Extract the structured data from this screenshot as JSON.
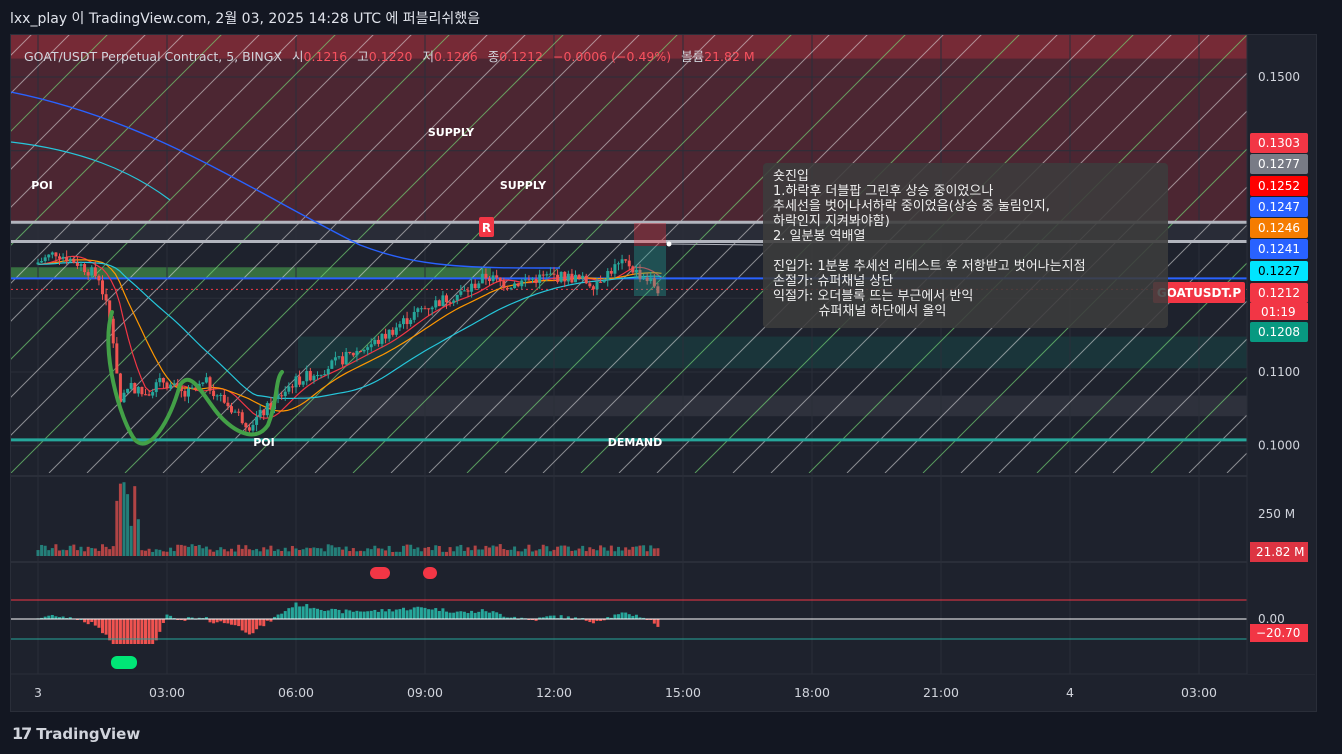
{
  "caption": "lxx_play 이 TradingView.com, 2월 03, 2025 14:28 UTC 에 퍼블리쉬했음",
  "brand": "TradingView",
  "symbol": {
    "name": "GOAT/USDT Perpetual Contract, 5, BINGX",
    "open_label": "시",
    "open": "0.1216",
    "high_label": "고",
    "high": "0.1220",
    "low_label": "저",
    "low": "0.1206",
    "close_label": "종",
    "close": "0.1212",
    "change": "−0.0006 (−0.49%)",
    "volume_label": "볼륨",
    "volume": "21.82 M"
  },
  "note": {
    "title": "숏진입",
    "lines": [
      "1.하락후 더블팝 그린후 상승 중이었으나",
      "추세선을 벗어나서하락 중이었음(상승 중 눌림인지,",
      "하락인지 지켜봐야함)",
      "2. 일분봉 역배열",
      "",
      "진입가: 1분봉 추세선 리테스트 후 저항받고 벗어나는지점",
      "손절가: 슈퍼채널 상단",
      "익절가: 오더블록 뜨는 부근에서 반익",
      "           슈퍼채널 하단에서 올익"
    ]
  },
  "chart_data": {
    "type": "line",
    "title": "GOAT/USDT Perpetual Contract, 5, BINGX",
    "x_ticks": [
      "3",
      "03:00",
      "06:00",
      "09:00",
      "12:00",
      "15:00",
      "18:00",
      "21:00",
      "4",
      "03:00"
    ],
    "y_ticks": [
      "0.1500",
      "0.1100",
      "0.1000"
    ],
    "ylim": [
      0.0963,
      0.1557
    ],
    "price_series": {
      "name": "GOATUSDT.P",
      "x_hours": [
        0.0,
        0.5,
        1.0,
        1.5,
        1.8,
        2.0,
        2.2,
        2.5,
        3.0,
        3.5,
        4.0,
        4.5,
        5.0,
        5.5,
        6.0,
        6.5,
        7.0,
        7.5,
        8.0,
        8.5,
        9.0,
        9.5,
        10.0,
        10.5,
        11.0,
        11.5,
        12.0,
        12.5,
        13.0,
        13.5,
        13.8,
        14.0,
        14.3,
        14.5
      ],
      "values": [
        0.1246,
        0.1262,
        0.1248,
        0.1228,
        0.116,
        0.106,
        0.1085,
        0.107,
        0.1088,
        0.1068,
        0.1085,
        0.1055,
        0.1028,
        0.1055,
        0.1085,
        0.1098,
        0.1112,
        0.1128,
        0.1142,
        0.1165,
        0.1185,
        0.1198,
        0.1208,
        0.123,
        0.1218,
        0.1225,
        0.123,
        0.1228,
        0.122,
        0.1242,
        0.1248,
        0.1235,
        0.1225,
        0.1212
      ]
    },
    "levels": [
      {
        "value": "0.1303",
        "color": "#f23645",
        "label": "SUPPLY"
      },
      {
        "value": "0.1277",
        "color": "#787b86",
        "label": "SUPPLY"
      },
      {
        "value": "0.1252",
        "color": "#ff0000",
        "label": ""
      },
      {
        "value": "0.1247",
        "color": "#2962ff",
        "label": ""
      },
      {
        "value": "0.1246",
        "color": "#f57c00",
        "label": ""
      },
      {
        "value": "0.1241",
        "color": "#2962ff",
        "label": ""
      },
      {
        "value": "0.1227",
        "color": "#00e5ff",
        "label": ""
      },
      {
        "value": "0.1212",
        "color": "#f23645",
        "label": "GOATUSDT.P"
      },
      {
        "value": "0.1208",
        "color": "#089981",
        "label": ""
      }
    ],
    "countdown": "01:19",
    "demand_label": "DEMAND",
    "poi_labels": [
      "POI",
      "POI"
    ],
    "marker": "R",
    "volume_panel": {
      "ticks": [
        "250 M"
      ],
      "last": "21.82 M"
    },
    "oscillator_panel": {
      "ticks": [
        "0.00"
      ],
      "last": "−20.70"
    },
    "legend": "none",
    "grid": true
  }
}
